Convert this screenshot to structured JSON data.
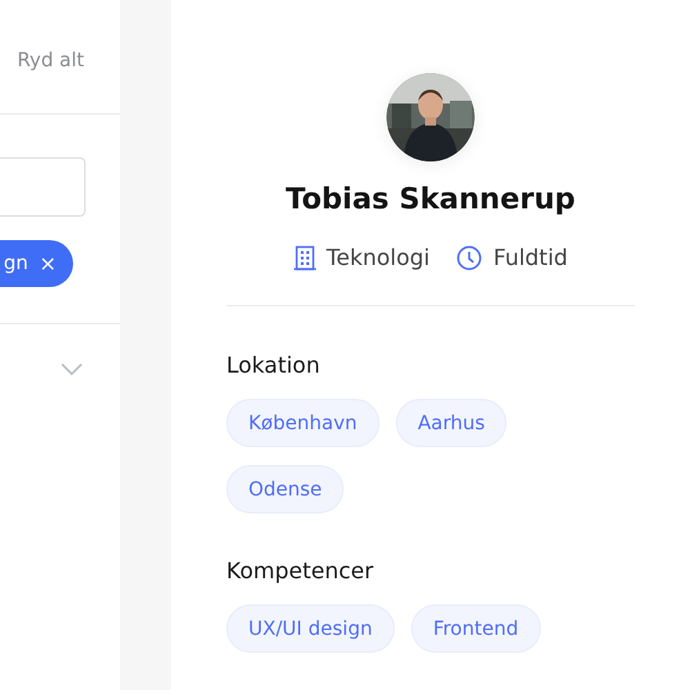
{
  "filter_panel": {
    "clear_all": "Ryd alt",
    "active_filter": {
      "label": "gn",
      "remove": "×"
    }
  },
  "profile": {
    "name": "Tobias Skannerup",
    "industry": "Teknologi",
    "employment": "Fuldtid",
    "sections": [
      {
        "title": "Lokation",
        "tags": [
          "København",
          "Aarhus",
          "Odense"
        ]
      },
      {
        "title": "Kompetencer",
        "tags": [
          "UX/UI design",
          "Frontend"
        ]
      }
    ]
  }
}
